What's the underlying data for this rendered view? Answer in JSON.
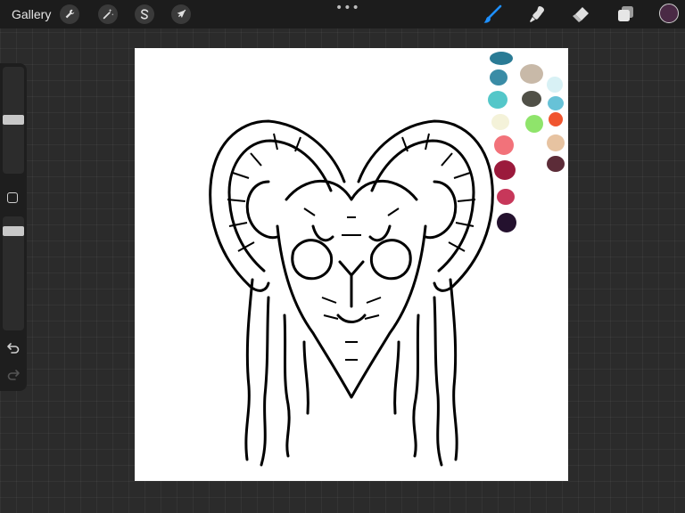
{
  "toolbar": {
    "gallery_label": "Gallery",
    "left_tools": [
      {
        "name": "actions",
        "icon": "wrench-icon"
      },
      {
        "name": "adjustments",
        "icon": "magic-wand-icon"
      },
      {
        "name": "selection",
        "icon": "selection-s-icon"
      },
      {
        "name": "transform",
        "icon": "arrow-cursor-icon"
      }
    ],
    "more_label": "•••",
    "right_tools": [
      {
        "name": "brush",
        "icon": "brush-icon",
        "active": true,
        "color": "#1e90ff"
      },
      {
        "name": "smudge",
        "icon": "smudge-icon",
        "active": false
      },
      {
        "name": "eraser",
        "icon": "eraser-icon",
        "active": false
      },
      {
        "name": "layers",
        "icon": "layers-icon",
        "active": false
      }
    ],
    "current_color": "#4a2a45"
  },
  "sidebar": {
    "brush_size_level": 0.48,
    "opacity_level": 0.15
  },
  "canvas": {
    "background": "#ffffff",
    "artwork": "ram-skull-line-art",
    "palette": [
      {
        "color": "#2a7b95"
      },
      {
        "color": "#3a8ca6"
      },
      {
        "color": "#54c7c9"
      },
      {
        "color": "#f4f2d9"
      },
      {
        "color": "#f2727a"
      },
      {
        "color": "#9b1a3c"
      },
      {
        "color": "#c7375a"
      },
      {
        "color": "#24112e"
      },
      {
        "color": "#c8b9a8"
      },
      {
        "color": "#505047"
      },
      {
        "color": "#8fe46b"
      },
      {
        "color": "#d8f1f5"
      },
      {
        "color": "#67c2d7"
      },
      {
        "color": "#f0552f"
      },
      {
        "color": "#e7c3a1"
      },
      {
        "color": "#5c2c38"
      }
    ]
  }
}
